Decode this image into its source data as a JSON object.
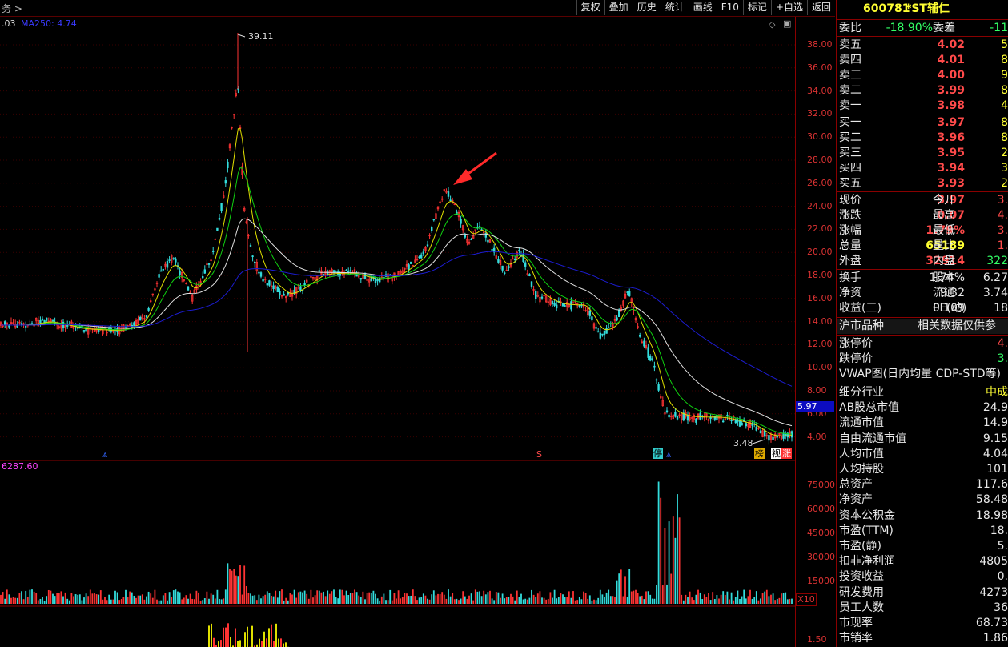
{
  "toolbar": {
    "left_label": "务 >",
    "buttons": [
      "复权",
      "叠加",
      "历史",
      "统计",
      "画线",
      "F10",
      "标记",
      "+自选",
      "返回"
    ]
  },
  "chart": {
    "legend_prefix": ".03",
    "ma_legend": "MA250: 4.74",
    "high_label": "39.11",
    "low_label": "3.48",
    "last_price_tag": "5.97",
    "volume_legend": "6287.60",
    "x10_label": "X10",
    "price_ticks": [
      "38.00",
      "36.00",
      "34.00",
      "32.00",
      "30.00",
      "28.00",
      "26.00",
      "24.00",
      "22.00",
      "20.00",
      "18.00",
      "16.00",
      "14.00",
      "12.00",
      "10.00",
      "8.00",
      "6.00",
      "4.00"
    ],
    "volume_ticks": [
      "75000",
      "60000",
      "45000",
      "30000",
      "15000"
    ],
    "indicator_ticks": [
      "1.50"
    ],
    "markers": {
      "s_marker": "S",
      "ting_flag": "停",
      "bang_flag": "榜",
      "shi_flag": "视",
      "zhang_flag": "涨"
    },
    "colors": {
      "ma250": "#1c1cd0",
      "ma_white": "#e0e0e0",
      "ma_yellow": "#e0e000",
      "ma_green": "#10d010",
      "up": "#ff3333",
      "down": "#33dddd"
    }
  },
  "panel": {
    "code": "600781",
    "name": "*ST辅仁",
    "weibi_label": "委比",
    "weibi_value": "-18.90%",
    "weicha_label": "委差",
    "weicha_value": "-11",
    "asks": [
      {
        "label": "卖五",
        "price": "4.02",
        "vol": "5"
      },
      {
        "label": "卖四",
        "price": "4.01",
        "vol": "8"
      },
      {
        "label": "卖三",
        "price": "4.00",
        "vol": "9"
      },
      {
        "label": "卖二",
        "price": "3.99",
        "vol": "8"
      },
      {
        "label": "卖一",
        "price": "3.98",
        "vol": "4"
      }
    ],
    "bids": [
      {
        "label": "买一",
        "price": "3.97",
        "vol": "8"
      },
      {
        "label": "买二",
        "price": "3.96",
        "vol": "8"
      },
      {
        "label": "买三",
        "price": "3.95",
        "vol": "2"
      },
      {
        "label": "买四",
        "price": "3.94",
        "vol": "3"
      },
      {
        "label": "买五",
        "price": "3.93",
        "vol": "2"
      }
    ],
    "quote": [
      {
        "l1": "现价",
        "v1": "3.97",
        "l2": "今开",
        "v2": "3."
      },
      {
        "l1": "涨跌",
        "v1": "0.07",
        "l2": "最高",
        "v2": "4."
      },
      {
        "l1": "涨幅",
        "v1": "1.79%",
        "l2": "最低",
        "v2": "3."
      },
      {
        "l1": "总量",
        "v1": "65189",
        "l2": "量比",
        "v2": "1."
      },
      {
        "l1": "外盘",
        "v1": "32914",
        "l2": "内盘",
        "v2": "322"
      }
    ],
    "stats": [
      {
        "l1": "换手",
        "v1": "1.74%",
        "l2": "股本",
        "v2": "6.27"
      },
      {
        "l1": "净资",
        "v1": "9.32",
        "l2": "流通",
        "v2": "3.74"
      },
      {
        "l1": "收益(三)",
        "v1": "0.109",
        "l2": "PE(动)",
        "v2": "18"
      }
    ],
    "market_label": "沪市品种",
    "market_note": "相关数据仅供参",
    "limit_up_label": "涨停价",
    "limit_up_value": "4.",
    "limit_down_label": "跌停价",
    "limit_down_value": "3.",
    "vwap_label": "VWAP图(日内均量 CDP-STD等)",
    "fundamentals": [
      {
        "label": "细分行业",
        "value": "中成"
      },
      {
        "label": "AB股总市值",
        "value": "24.9"
      },
      {
        "label": "流通市值",
        "value": "14.9"
      },
      {
        "label": "自由流通市值",
        "value": "9.15"
      },
      {
        "label": "人均市值",
        "value": "4.04"
      },
      {
        "label": "人均持股",
        "value": "101"
      },
      {
        "label": "总资产",
        "value": "117.6"
      },
      {
        "label": "净资产",
        "value": "58.48"
      },
      {
        "label": "资本公积金",
        "value": "18.98"
      },
      {
        "label": "市盈(TTM)",
        "value": "18."
      },
      {
        "label": "市盈(静)",
        "value": "5."
      },
      {
        "label": "扣非净利润",
        "value": "4805"
      },
      {
        "label": "投资收益",
        "value": "0."
      },
      {
        "label": "研发费用",
        "value": "4273"
      },
      {
        "label": "员工人数",
        "value": "36"
      },
      {
        "label": "市现率",
        "value": "68.73"
      },
      {
        "label": "市销率",
        "value": "1.86"
      }
    ]
  }
}
